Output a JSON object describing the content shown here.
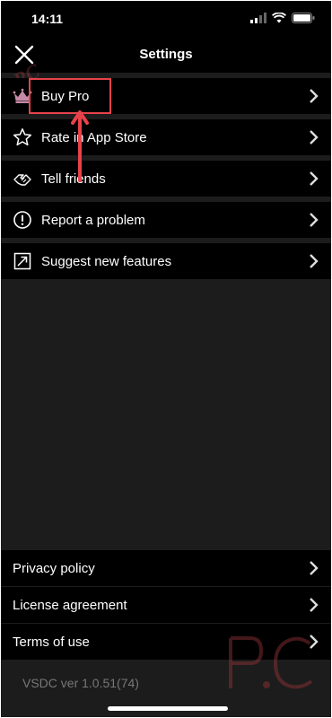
{
  "status_bar": {
    "time": "14:11"
  },
  "header": {
    "title": "Settings",
    "watermark": "PC"
  },
  "menu": [
    {
      "label": "Buy Pro",
      "icon": "crown-icon"
    },
    {
      "label": "Rate in App Store",
      "icon": "star-icon"
    },
    {
      "label": "Tell friends",
      "icon": "handshake-icon"
    },
    {
      "label": "Report a problem",
      "icon": "exclamation-circle-icon"
    },
    {
      "label": "Suggest new features",
      "icon": "external-arrow-icon"
    }
  ],
  "footer_links": [
    {
      "label": "Privacy policy"
    },
    {
      "label": "License agreement"
    },
    {
      "label": "Terms of use"
    }
  ],
  "version": "VSDC ver 1.0.51(74)",
  "annotation": {
    "color": "#e8424b"
  },
  "colors": {
    "background": "#1c1c1c",
    "row": "#000000",
    "text": "#ffffff"
  }
}
